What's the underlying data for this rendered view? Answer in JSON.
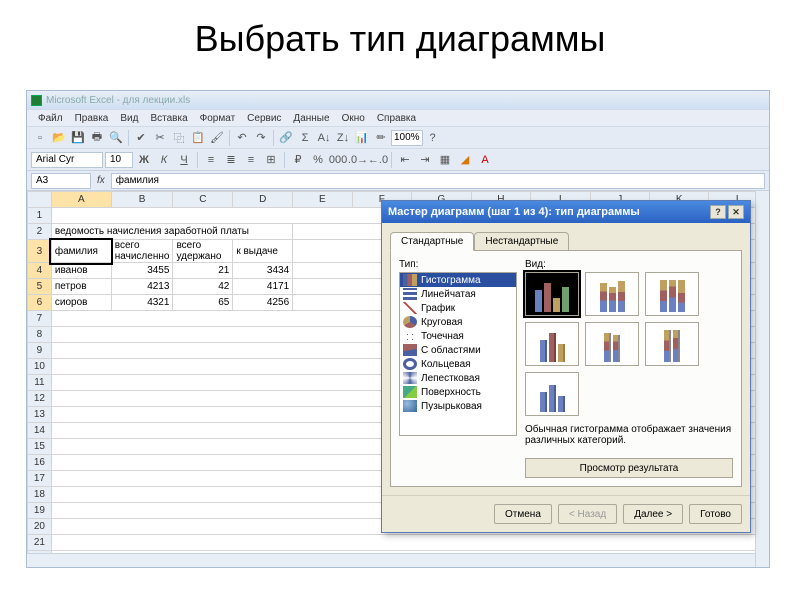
{
  "slide": {
    "title": "Выбрать тип диаграммы"
  },
  "window": {
    "title": "Microsoft Excel - для лекции.xls"
  },
  "menu": {
    "items": [
      "Файл",
      "Правка",
      "Вид",
      "Вставка",
      "Формат",
      "Сервис",
      "Данные",
      "Окно",
      "Справка"
    ]
  },
  "toolbar": {
    "zoom": "100%"
  },
  "format": {
    "font": "Arial Cyr",
    "size": "10"
  },
  "cellref": {
    "name": "A3",
    "formula": "фамилия"
  },
  "columns": [
    "A",
    "B",
    "C",
    "D",
    "E",
    "F",
    "G",
    "H",
    "I",
    "J",
    "K",
    "L"
  ],
  "sheet": {
    "title": "ведомость начисления заработной платы",
    "headers": [
      "фамилия",
      "всего начисленно",
      "всего удержано",
      "к выдаче"
    ],
    "rows": [
      {
        "name": "иванов",
        "v1": "3455",
        "v2": "21",
        "v3": "3434"
      },
      {
        "name": "петров",
        "v1": "4213",
        "v2": "42",
        "v3": "4171"
      },
      {
        "name": "сиоров",
        "v1": "4321",
        "v2": "65",
        "v3": "4256"
      }
    ]
  },
  "dialog": {
    "title": "Мастер диаграмм (шаг 1 из 4): тип диаграммы",
    "tabs": {
      "standard": "Стандартные",
      "custom": "Нестандартные"
    },
    "type_label": "Тип:",
    "view_label": "Вид:",
    "types": [
      "Гистограмма",
      "Линейчатая",
      "График",
      "Круговая",
      "Точечная",
      "С областями",
      "Кольцевая",
      "Лепестковая",
      "Поверхность",
      "Пузырьковая"
    ],
    "description": "Обычная гистограмма отображает значения различных категорий.",
    "preview": "Просмотр результата",
    "buttons": {
      "cancel": "Отмена",
      "back": "< Назад",
      "next": "Далее >",
      "finish": "Готово"
    }
  }
}
